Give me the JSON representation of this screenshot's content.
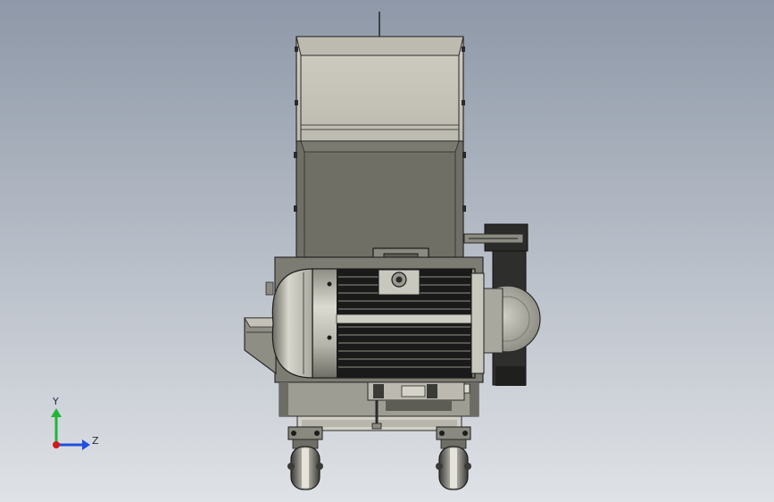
{
  "scene": {
    "background_top": "#8e98a8",
    "background_bottom": "#dfe2e6",
    "machine_body_color": "#6f6f66",
    "motor_color": "#b9b8ad",
    "fin_color": "#1a1a1a"
  },
  "triad": {
    "y_label": "Y",
    "z_label": "Z",
    "y_color": "#1fb53a",
    "z_color": "#1f4fe0",
    "x_color": "#d01a1a"
  }
}
